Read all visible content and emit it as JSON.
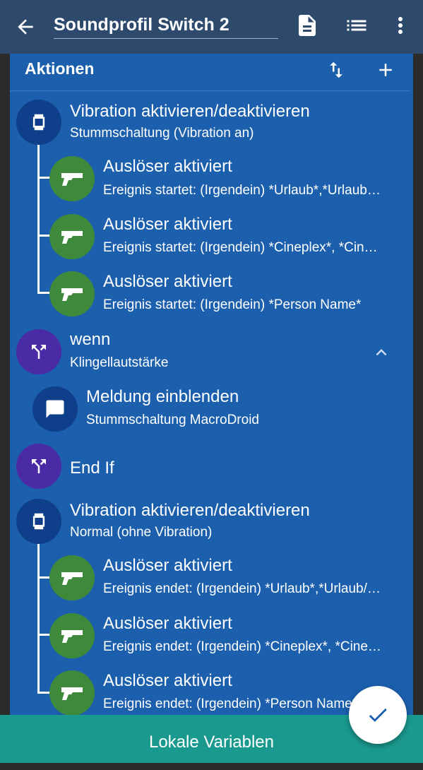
{
  "appbar": {
    "title": "Soundprofil Switch 2"
  },
  "panel": {
    "title": "Aktionen"
  },
  "items": [
    {
      "title": "Vibration aktivieren/deaktivieren",
      "subtitle": "Stummschaltung (Vibration an)"
    },
    {
      "title": "Auslöser aktiviert",
      "subtitle": "Ereignis startet: (Irgendein) *Urlaub*,*Urlaub…"
    },
    {
      "title": "Auslöser aktiviert",
      "subtitle": "Ereignis startet: (Irgendein) *Cineplex*, *Cin…"
    },
    {
      "title": "Auslöser aktiviert",
      "subtitle": "Ereignis startet: (Irgendein) *Person Name*"
    },
    {
      "title": "wenn",
      "subtitle": "Klingellautstärke"
    },
    {
      "title": "Meldung einblenden",
      "subtitle": "Stummschaltung MacroDroid"
    },
    {
      "title": "End If"
    },
    {
      "title": "Vibration aktivieren/deaktivieren",
      "subtitle": "Normal (ohne Vibration)"
    },
    {
      "title": "Auslöser aktiviert",
      "subtitle": "Ereignis endet: (Irgendein) *Urlaub*,*Urlaub/…"
    },
    {
      "title": "Auslöser aktiviert",
      "subtitle": "Ereignis endet: (Irgendein) *Cineplex*, *Cine…"
    },
    {
      "title": "Auslöser aktiviert",
      "subtitle": "Ereignis endet: (Irgendein) *Person Name*"
    }
  ],
  "bottom": {
    "label": "Lokale Variablen"
  },
  "colors": {
    "appbar": "#2d4a6d",
    "panel": "#1b5fad",
    "navy": "#0f3f8b",
    "green": "#3f8a3a",
    "purple": "#4b2aa5",
    "bottom": "#1a9a8e"
  },
  "icons": [
    "back-arrow-icon",
    "document-icon",
    "list-icon",
    "more-vert-icon",
    "sort-icon",
    "add-icon",
    "vibration-icon",
    "gun-icon",
    "branch-icon",
    "message-icon",
    "chevron-up-icon",
    "check-icon"
  ]
}
